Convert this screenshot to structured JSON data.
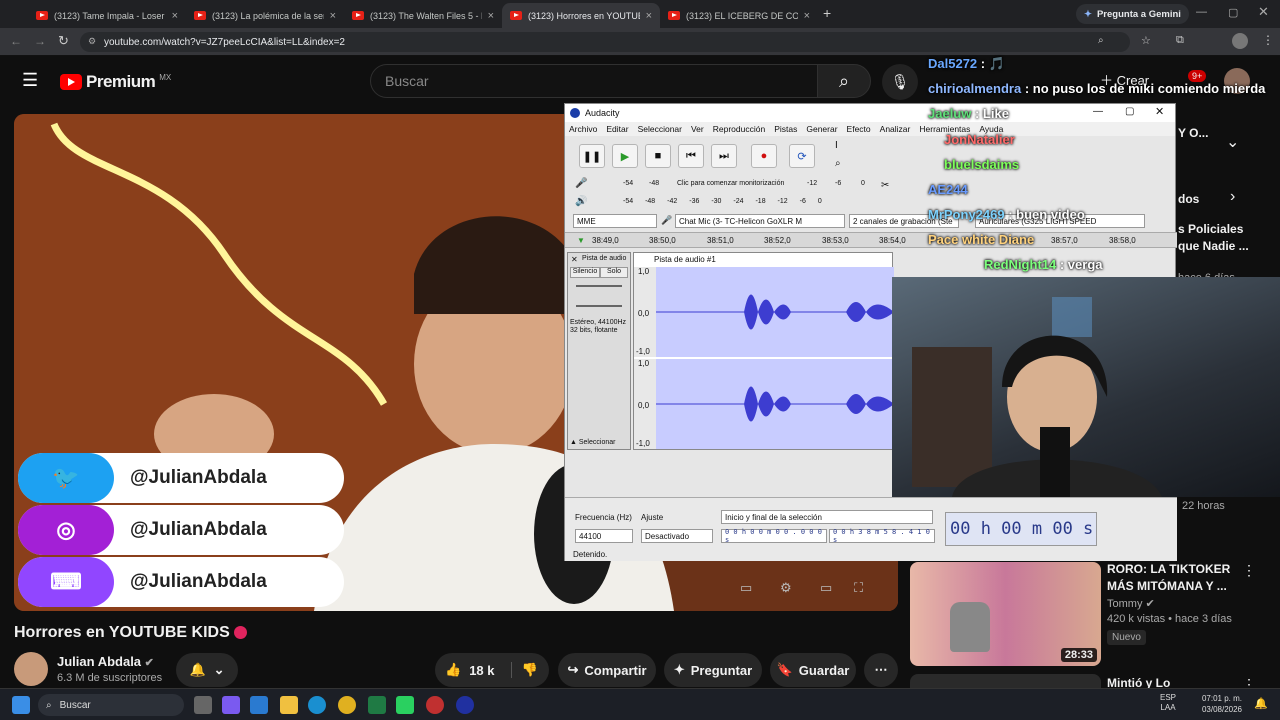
{
  "browser": {
    "tabs": [
      {
        "title": "(3123) Tame Impala - Loser (Of"
      },
      {
        "title": "(3123) La polémica de la serie l"
      },
      {
        "title": "(3123) The Walten Files 5 - Face"
      },
      {
        "title": "(3123) Horrores en YOUTUBE KI"
      },
      {
        "title": "(3123) EL ICEBERG DE COCA CO"
      }
    ],
    "gemini_button": "Pregunta a Gemini",
    "url": "youtube.com/watch?v=JZ7peeLcCIA&list=LL&index=2"
  },
  "youtube": {
    "logo_text": "Premium",
    "logo_badge": "MX",
    "search_placeholder": "Buscar",
    "create_label": "Crear",
    "notif_count": "9+",
    "video_title": "Horrores en YOUTUBE KIDS",
    "channel_name": "Julian Abdala",
    "subscribers": "6.3 M de suscriptores",
    "likes": "18 k",
    "share": "Compartir",
    "ask": "Preguntar",
    "save": "Guardar",
    "socials": [
      {
        "handle": "@JulianAbdala",
        "color": "#1da1f2",
        "icon": "twitter-icon"
      },
      {
        "handle": "@JulianAbdala",
        "color": "#a320d6",
        "icon": "instagram-icon"
      },
      {
        "handle": "@JulianAbdala",
        "color": "#9146ff",
        "icon": "twitch-icon"
      }
    ],
    "sidebar": {
      "partial_top": "Y O...",
      "partial_tab": "dos",
      "partial_rec1_line1": "s Policiales",
      "partial_rec1_line2": "que Nadie ...",
      "partial_rec1_meta": "hace 6 días",
      "partial_time": "22 horas",
      "rec_title_line1": "RORO: LA TIKTOKER",
      "rec_title_line2": "MÁS MITÓMANA Y ...",
      "rec_channel": "Tommy",
      "rec_meta": "420 k vistas • hace 3 días",
      "rec_badge": "Nuevo",
      "rec_duration": "28:33",
      "next_title": "Mintió y Lo"
    }
  },
  "audacity": {
    "title": "Audacity",
    "menu": [
      "Archivo",
      "Editar",
      "Seleccionar",
      "Ver",
      "Reproducción",
      "Pistas",
      "Generar",
      "Efecto",
      "Analizar",
      "Herramientas",
      "Ayuda"
    ],
    "monitor_hint": "Clic para comenzar monitorización",
    "meter_ticks": [
      "-54",
      "-48",
      "-12",
      "-6",
      "0"
    ],
    "meter_ticks2": [
      "-54",
      "-48",
      "-42",
      "-36",
      "-30",
      "-24",
      "-18",
      "-12",
      "-6",
      "0"
    ],
    "host": "MME",
    "input_device": "Chat Mic (3- TC-Helicon GoXLR M",
    "channels": "2 canales de grabación (Ste",
    "output_device": "Auriculares (G325 LIGHTSPEED",
    "ruler_ticks": [
      "38:49,0",
      "38:50,0",
      "38:51,0",
      "38:52,0",
      "38:53,0",
      "38:54,0",
      "38:57,0",
      "38:58,0"
    ],
    "track_name": "Pista de audio",
    "track_title": "Pista de audio #1",
    "mute": "Silencio",
    "solo": "Solo",
    "track_info_1": "Estéreo, 44100Hz",
    "track_info_2": "32 bits, flotante",
    "select_label": "Seleccionar",
    "scale_labels": [
      "1,0",
      "0,0",
      "-1,0",
      "1,0",
      "0,0",
      "-1,0"
    ],
    "freq_label": "Frecuencia (Hz)",
    "snap_label": "Ajuste",
    "sel_mode": "Inicio y final de la selección",
    "freq_value": "44100",
    "snap_value": "Desactivado",
    "time1": "0 0 h 0 0 m 0 0 . 0 0 0 s",
    "time2": "0 0 h 3 8 m 5 8 . 4 1 0 s",
    "big_time": "00 h 00 m 00 s",
    "status": "Detenido."
  },
  "chat": [
    {
      "user": "Dal5272",
      "msg": "🎵",
      "color": "#6aa8ff"
    },
    {
      "user": "chirioalmendra",
      "msg": "no puso los de miki comiendo mierda",
      "color": "#8fb8ff"
    },
    {
      "user": "Jaeluw",
      "msg": "Like",
      "color": "#5fe07a"
    },
    {
      "user": "JonNatalier",
      "msg": "",
      "color": "#ff6a6a"
    },
    {
      "user": "bluelsdaims",
      "msg": "",
      "color": "#7dff5a"
    },
    {
      "user": "AE244",
      "msg": "",
      "color": "#6a9cff"
    },
    {
      "user": "MrPony2469",
      "msg": "buen video",
      "color": "#7dd3ff"
    },
    {
      "user": "Pace white Diane",
      "msg": "",
      "color": "#ffd27d"
    },
    {
      "user": "RedNight14",
      "msg": "verga",
      "color": "#7dff7d"
    }
  ],
  "taskbar": {
    "search": "Buscar",
    "lang1": "ESP",
    "lang2": "LAA",
    "time": "07:01 p. m.",
    "date": "03/08/2026"
  }
}
